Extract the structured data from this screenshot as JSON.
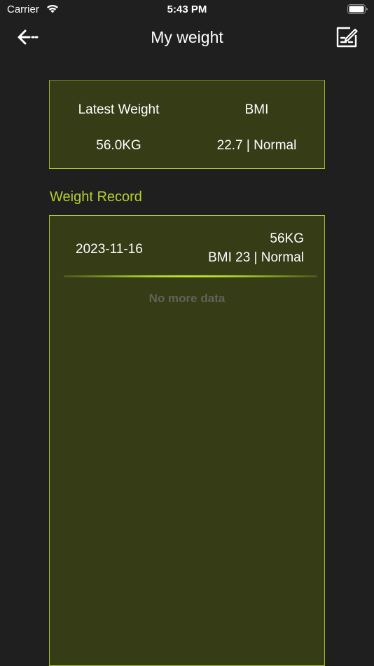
{
  "status_bar": {
    "carrier": "Carrier",
    "time": "5:43 PM",
    "wifi_icon": "wifi-icon",
    "battery_icon": "battery-icon"
  },
  "nav": {
    "title": "My weight",
    "back_icon": "back-arrow-icon",
    "edit_icon": "edit-note-icon"
  },
  "summary": {
    "latest_weight_label": "Latest Weight",
    "latest_weight_value": "56.0KG",
    "bmi_label": "BMI",
    "bmi_value": "22.7 | Normal"
  },
  "records": {
    "section_title": "Weight Record",
    "items": [
      {
        "date": "2023-11-16",
        "weight": "56KG",
        "bmi": "BMI 23 | Normal"
      }
    ],
    "empty_text": "No more data"
  },
  "colors": {
    "background": "#1f1f1f",
    "card": "#353c16",
    "accent": "#b3d12f"
  }
}
